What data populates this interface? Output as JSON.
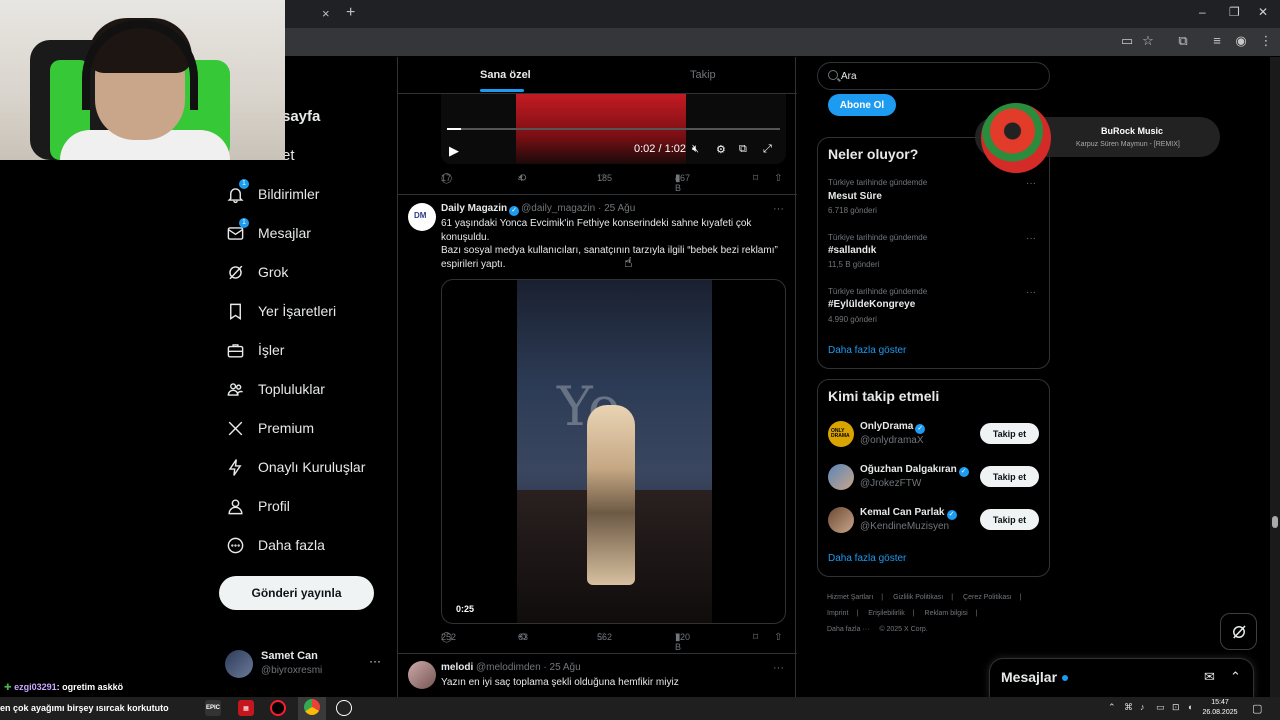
{
  "browser": {
    "tab_close": "×",
    "new_tab": "+",
    "window_controls": [
      "–",
      "❐",
      "✕"
    ]
  },
  "nav": {
    "partial_home": "sayfa",
    "partial_explore": "et",
    "items": [
      {
        "label": "Bildirimler",
        "icon": "bell-icon",
        "badge": "1"
      },
      {
        "label": "Mesajlar",
        "icon": "envelope-icon",
        "badge": "1"
      },
      {
        "label": "Grok",
        "icon": "grok-icon"
      },
      {
        "label": "Yer İşaretleri",
        "icon": "bookmark-icon"
      },
      {
        "label": "İşler",
        "icon": "briefcase-icon"
      },
      {
        "label": "Topluluklar",
        "icon": "people-icon"
      },
      {
        "label": "Premium",
        "icon": "x-logo-icon"
      },
      {
        "label": "Onaylı Kuruluşlar",
        "icon": "lightning-icon"
      },
      {
        "label": "Profil",
        "icon": "person-icon"
      },
      {
        "label": "Daha fazla",
        "icon": "more-circle-icon"
      }
    ],
    "post_button": "Gönderi yayınla",
    "account": {
      "name": "Samet Can",
      "handle": "@biyroxresmi",
      "more": "···"
    }
  },
  "feed": {
    "tabs": [
      "Sana özel",
      "Takip"
    ],
    "active_tab": 0,
    "post1": {
      "video_time": "0:02 / 1:02",
      "stats": {
        "replies": "17",
        "reposts": "4",
        "likes": "185",
        "views": "467 B"
      }
    },
    "post2": {
      "name": "Daily Magazin",
      "handle": "@daily_magazin",
      "date": "· 25 Ağu",
      "text_line1": "61 yaşındaki Yonca Evcimik'in Fethiye konserindeki sahne kıyafeti çok konuşuldu.",
      "text_line2": "Bazı sosyal medya kullanıcıları, sanatçının tarzıyla ilgili “bebek bezi reklamı” espirileri yaptı.",
      "video_duration": "0:25",
      "video_bg_text": "Yo",
      "stats": {
        "replies": "252",
        "reposts": "63",
        "likes": "562",
        "views": "720 B"
      }
    },
    "post3": {
      "name": "melodi",
      "handle": "@melodimden",
      "date": "· 25 Ağu",
      "text": "Yazın en iyi saç toplama şekli olduğuna hemfikir miyiz"
    },
    "more": "···"
  },
  "sidebar": {
    "search_placeholder": "Ara",
    "subscribe_label": "Abone Ol",
    "trends_title": "Neler oluyor?",
    "trends": [
      {
        "context": "Türkiye tarihinde gündemde",
        "name": "Mesut Süre",
        "count": "6.718 gönderi"
      },
      {
        "context": "Türkiye tarihinde gündemde",
        "name": "#sallandık",
        "count": "11,5 B gönderi"
      },
      {
        "context": "Türkiye tarihinde gündemde",
        "name": "#EylüldeKongreye",
        "count": "4.990 gönderi"
      }
    ],
    "show_more": "Daha fazla göster",
    "wtf_title": "Kimi takip etmeli",
    "who_to_follow": [
      {
        "name": "OnlyDrama",
        "handle": "@onlydramaX"
      },
      {
        "name": "Oğuzhan Dalgakıran",
        "handle": "@JrokezFTW"
      },
      {
        "name": "Kemal Can Parlak",
        "handle": "@KendineMuzisyen"
      }
    ],
    "follow_label": "Takip et",
    "footer_links": [
      "Hizmet Şartları",
      "Gizlilik Politikası",
      "Çerez Politikası",
      "Imprint",
      "Erişilebilirlik",
      "Reklam bilgisi",
      "Daha fazla ···",
      "© 2025 X Corp."
    ]
  },
  "music_widget": {
    "title": "BuRock Music",
    "subtitle": "Karpuz Süren Maymun - [REMIX]"
  },
  "messages_drawer": {
    "title": "Mesajlar"
  },
  "chat_overlay": {
    "user": "ezgi03291",
    "message1": ": ogretim askkö",
    "message2": "en çok ayağımı birşey ısırcak korkututo"
  },
  "taskbar": {
    "time": "15:47",
    "date": "26.08.2025"
  },
  "colors": {
    "accent": "#1d9bf0",
    "background": "#000000",
    "border": "#2f3336",
    "muted": "#71767b"
  }
}
